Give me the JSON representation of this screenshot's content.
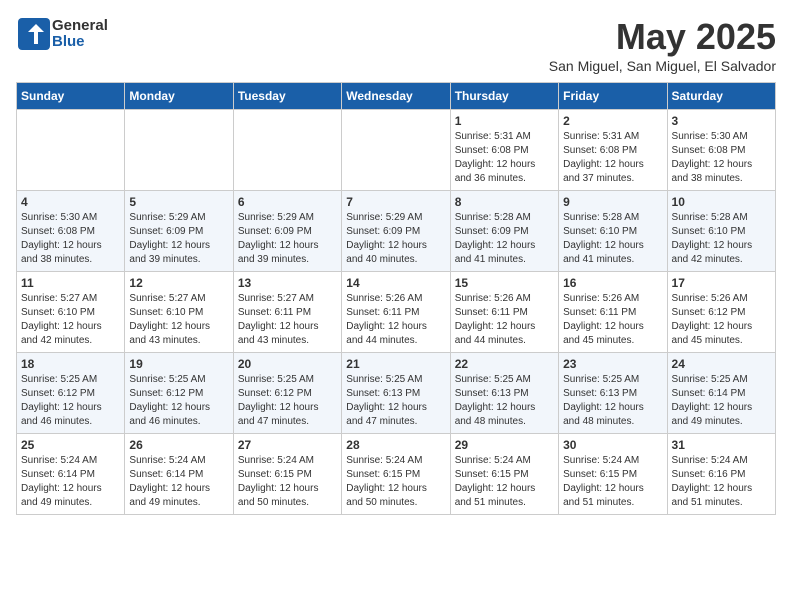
{
  "header": {
    "logo_general": "General",
    "logo_blue": "Blue",
    "month": "May 2025",
    "location": "San Miguel, San Miguel, El Salvador"
  },
  "weekdays": [
    "Sunday",
    "Monday",
    "Tuesday",
    "Wednesday",
    "Thursday",
    "Friday",
    "Saturday"
  ],
  "weeks": [
    [
      {
        "day": "",
        "info": ""
      },
      {
        "day": "",
        "info": ""
      },
      {
        "day": "",
        "info": ""
      },
      {
        "day": "",
        "info": ""
      },
      {
        "day": "1",
        "info": "Sunrise: 5:31 AM\nSunset: 6:08 PM\nDaylight: 12 hours\nand 36 minutes."
      },
      {
        "day": "2",
        "info": "Sunrise: 5:31 AM\nSunset: 6:08 PM\nDaylight: 12 hours\nand 37 minutes."
      },
      {
        "day": "3",
        "info": "Sunrise: 5:30 AM\nSunset: 6:08 PM\nDaylight: 12 hours\nand 38 minutes."
      }
    ],
    [
      {
        "day": "4",
        "info": "Sunrise: 5:30 AM\nSunset: 6:08 PM\nDaylight: 12 hours\nand 38 minutes."
      },
      {
        "day": "5",
        "info": "Sunrise: 5:29 AM\nSunset: 6:09 PM\nDaylight: 12 hours\nand 39 minutes."
      },
      {
        "day": "6",
        "info": "Sunrise: 5:29 AM\nSunset: 6:09 PM\nDaylight: 12 hours\nand 39 minutes."
      },
      {
        "day": "7",
        "info": "Sunrise: 5:29 AM\nSunset: 6:09 PM\nDaylight: 12 hours\nand 40 minutes."
      },
      {
        "day": "8",
        "info": "Sunrise: 5:28 AM\nSunset: 6:09 PM\nDaylight: 12 hours\nand 41 minutes."
      },
      {
        "day": "9",
        "info": "Sunrise: 5:28 AM\nSunset: 6:10 PM\nDaylight: 12 hours\nand 41 minutes."
      },
      {
        "day": "10",
        "info": "Sunrise: 5:28 AM\nSunset: 6:10 PM\nDaylight: 12 hours\nand 42 minutes."
      }
    ],
    [
      {
        "day": "11",
        "info": "Sunrise: 5:27 AM\nSunset: 6:10 PM\nDaylight: 12 hours\nand 42 minutes."
      },
      {
        "day": "12",
        "info": "Sunrise: 5:27 AM\nSunset: 6:10 PM\nDaylight: 12 hours\nand 43 minutes."
      },
      {
        "day": "13",
        "info": "Sunrise: 5:27 AM\nSunset: 6:11 PM\nDaylight: 12 hours\nand 43 minutes."
      },
      {
        "day": "14",
        "info": "Sunrise: 5:26 AM\nSunset: 6:11 PM\nDaylight: 12 hours\nand 44 minutes."
      },
      {
        "day": "15",
        "info": "Sunrise: 5:26 AM\nSunset: 6:11 PM\nDaylight: 12 hours\nand 44 minutes."
      },
      {
        "day": "16",
        "info": "Sunrise: 5:26 AM\nSunset: 6:11 PM\nDaylight: 12 hours\nand 45 minutes."
      },
      {
        "day": "17",
        "info": "Sunrise: 5:26 AM\nSunset: 6:12 PM\nDaylight: 12 hours\nand 45 minutes."
      }
    ],
    [
      {
        "day": "18",
        "info": "Sunrise: 5:25 AM\nSunset: 6:12 PM\nDaylight: 12 hours\nand 46 minutes."
      },
      {
        "day": "19",
        "info": "Sunrise: 5:25 AM\nSunset: 6:12 PM\nDaylight: 12 hours\nand 46 minutes."
      },
      {
        "day": "20",
        "info": "Sunrise: 5:25 AM\nSunset: 6:12 PM\nDaylight: 12 hours\nand 47 minutes."
      },
      {
        "day": "21",
        "info": "Sunrise: 5:25 AM\nSunset: 6:13 PM\nDaylight: 12 hours\nand 47 minutes."
      },
      {
        "day": "22",
        "info": "Sunrise: 5:25 AM\nSunset: 6:13 PM\nDaylight: 12 hours\nand 48 minutes."
      },
      {
        "day": "23",
        "info": "Sunrise: 5:25 AM\nSunset: 6:13 PM\nDaylight: 12 hours\nand 48 minutes."
      },
      {
        "day": "24",
        "info": "Sunrise: 5:25 AM\nSunset: 6:14 PM\nDaylight: 12 hours\nand 49 minutes."
      }
    ],
    [
      {
        "day": "25",
        "info": "Sunrise: 5:24 AM\nSunset: 6:14 PM\nDaylight: 12 hours\nand 49 minutes."
      },
      {
        "day": "26",
        "info": "Sunrise: 5:24 AM\nSunset: 6:14 PM\nDaylight: 12 hours\nand 49 minutes."
      },
      {
        "day": "27",
        "info": "Sunrise: 5:24 AM\nSunset: 6:15 PM\nDaylight: 12 hours\nand 50 minutes."
      },
      {
        "day": "28",
        "info": "Sunrise: 5:24 AM\nSunset: 6:15 PM\nDaylight: 12 hours\nand 50 minutes."
      },
      {
        "day": "29",
        "info": "Sunrise: 5:24 AM\nSunset: 6:15 PM\nDaylight: 12 hours\nand 51 minutes."
      },
      {
        "day": "30",
        "info": "Sunrise: 5:24 AM\nSunset: 6:15 PM\nDaylight: 12 hours\nand 51 minutes."
      },
      {
        "day": "31",
        "info": "Sunrise: 5:24 AM\nSunset: 6:16 PM\nDaylight: 12 hours\nand 51 minutes."
      }
    ]
  ]
}
